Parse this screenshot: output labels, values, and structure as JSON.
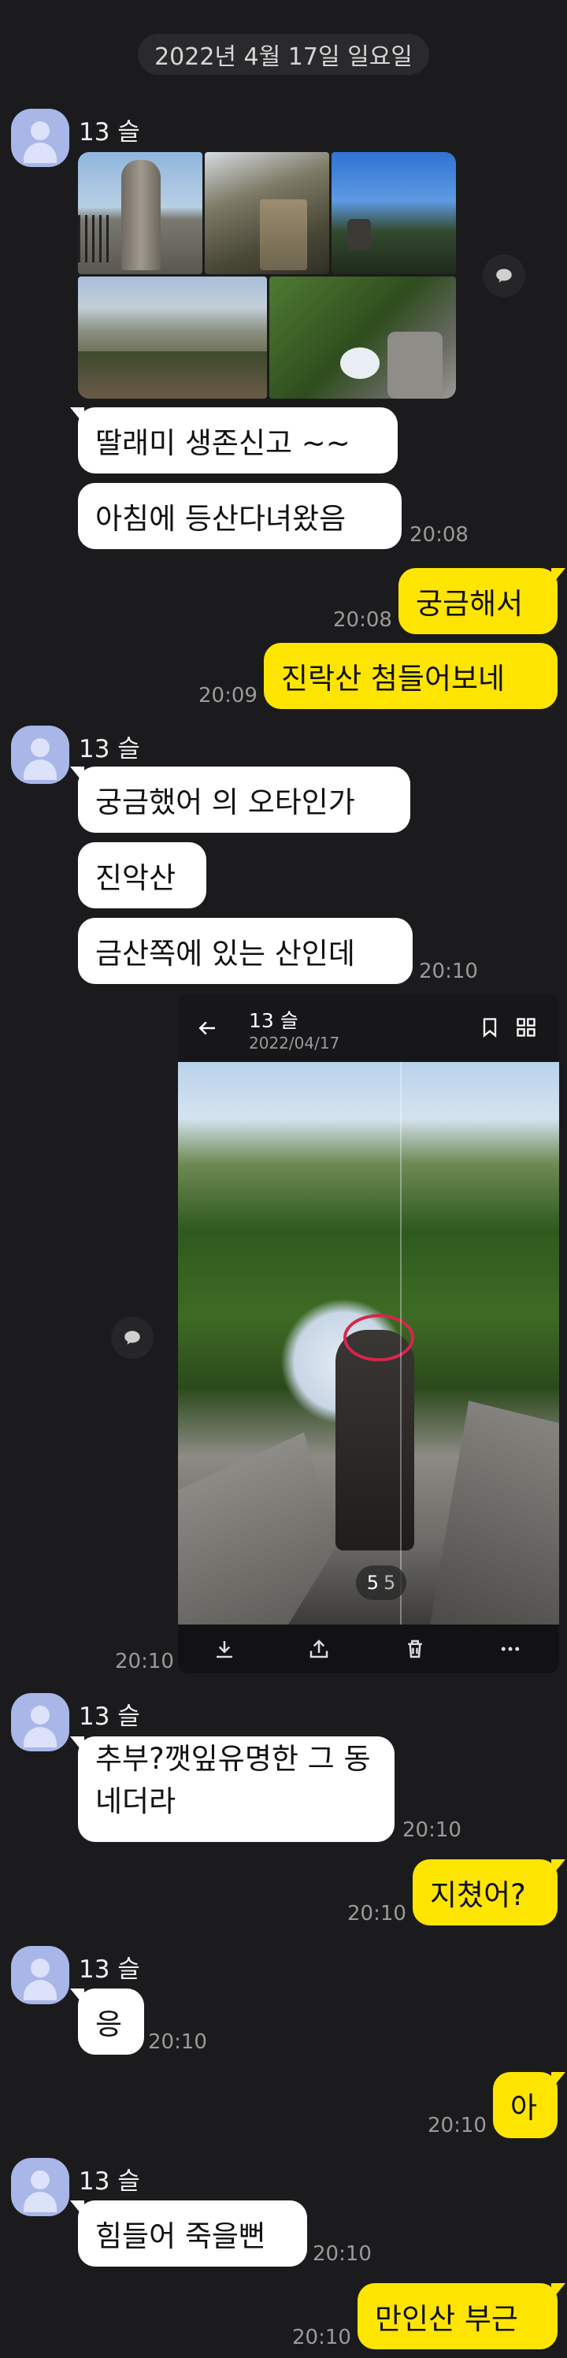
{
  "date_divider": "2022년 4월 17일 일요일",
  "sender_name": "13 슬",
  "messages": {
    "m1": "딸래미 생존신고 ~~",
    "m2": "아침에 등산다녀왔음",
    "m2_time": "20:08",
    "r1": "궁금해서",
    "r1_time": "20:08",
    "r2": "진락산 첨들어보네",
    "r2_time": "20:09",
    "m3": "궁금했어 의 오타인가",
    "m4": "진악산",
    "m5": "금산쪽에 있는 산인데",
    "m5_time": "20:10",
    "photo_time": "20:10",
    "m6": "추부?깻잎유명한 그 동네더라",
    "m6_time": "20:10",
    "r3": "지쳤어?",
    "r3_time": "20:10",
    "m7": "응",
    "m7_time": "20:10",
    "r4": "아",
    "r4_time": "20:10",
    "m8": "힘들어 죽을뻔",
    "m8_time": "20:10",
    "r5": "만인산 부근",
    "r5_time": "20:10"
  },
  "viewer": {
    "sender": "13 슬",
    "date": "2022/04/17",
    "counter_current": "5",
    "counter_total": "5"
  },
  "icons": [
    "share-icon",
    "back-arrow-icon",
    "bookmark-icon",
    "grid-icon",
    "download-icon",
    "upload-icon",
    "trash-icon",
    "more-icon"
  ],
  "colors": {
    "background": "#1b1b1d",
    "my_bubble": "#fee500",
    "their_bubble": "#ffffff",
    "avatar": "#a9b6e8"
  }
}
